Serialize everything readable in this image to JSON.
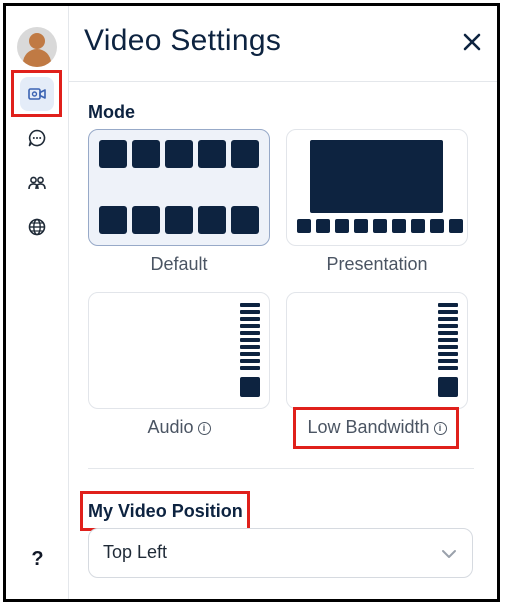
{
  "header": {
    "title": "Video Settings",
    "close_icon": "close-icon"
  },
  "rail": {
    "items": [
      {
        "name": "avatar",
        "active": false
      },
      {
        "name": "video-settings-icon",
        "active": true
      },
      {
        "name": "chat-icon",
        "active": false
      },
      {
        "name": "participants-icon",
        "active": false
      },
      {
        "name": "globe-icon",
        "active": false
      }
    ],
    "help_label": "?"
  },
  "mode": {
    "label": "Mode",
    "options": [
      {
        "label": "Default",
        "selected": true,
        "info": false
      },
      {
        "label": "Presentation",
        "selected": false,
        "info": false
      },
      {
        "label": "Audio",
        "selected": false,
        "info": true
      },
      {
        "label": "Low Bandwidth",
        "selected": false,
        "info": true
      }
    ],
    "info_glyph": "i"
  },
  "video_position": {
    "label": "My Video Position",
    "selected": "Top Left"
  },
  "colors": {
    "tile": "#0d2340",
    "accent": "#e0201b",
    "selected_bg": "#eef2f9"
  }
}
